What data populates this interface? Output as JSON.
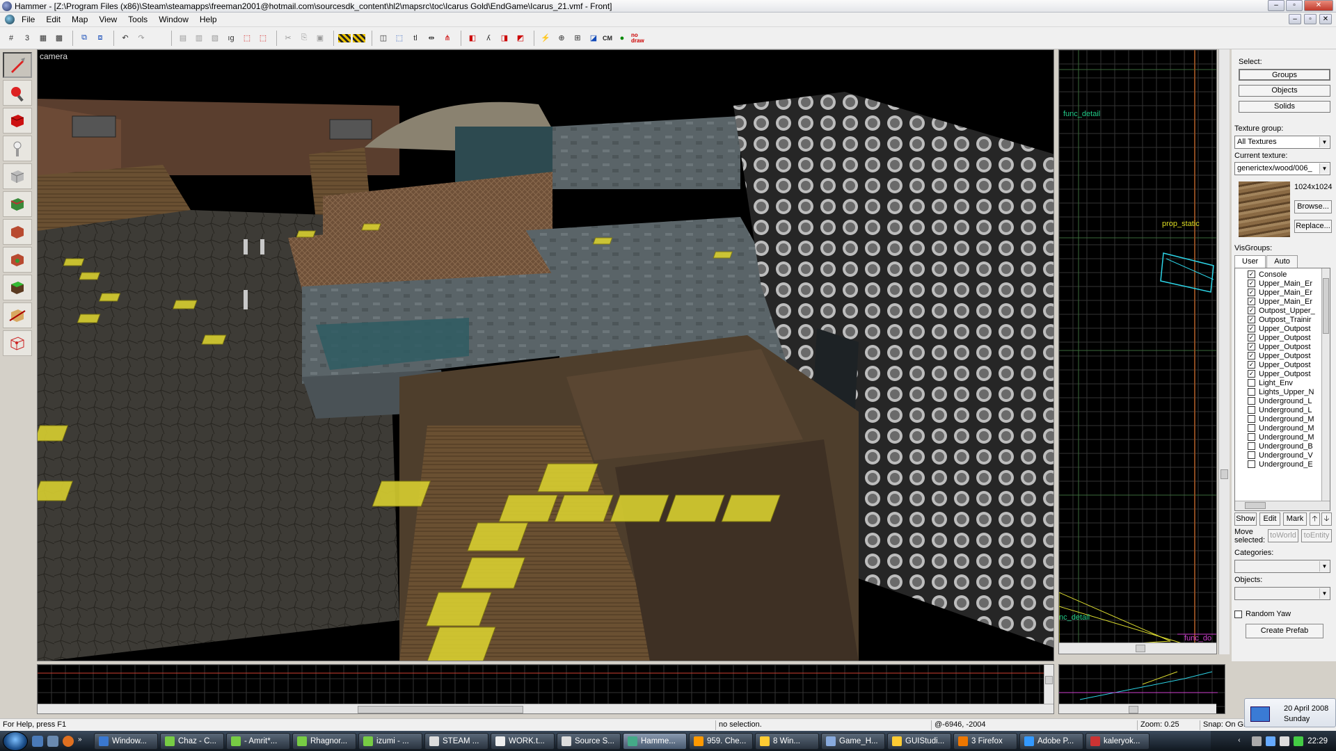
{
  "window": {
    "title": "Hammer - [Z:\\Program Files (x86)\\Steam\\steamapps\\freeman2001@hotmail.com\\sourcesdk_content\\hl2\\mapsrc\\toc\\Icarus Gold\\EndGame\\Icarus_21.vmf - Front]",
    "minimize": "–",
    "maximize": "▫",
    "close": "✕"
  },
  "menu": [
    "File",
    "Edit",
    "Map",
    "View",
    "Tools",
    "Window",
    "Help"
  ],
  "toolbar": {
    "cordon_label": "CM",
    "nodraw_label": "no draw"
  },
  "view3d": {
    "label": "camera"
  },
  "view2d": {
    "labels": [
      "func_detail",
      "prop_static",
      "nc_detail",
      "func_do"
    ]
  },
  "panel": {
    "select_label": "Select:",
    "groups_btn": "Groups",
    "objects_btn": "Objects",
    "solids_btn": "Solids",
    "texture_group_label": "Texture group:",
    "texture_group_value": "All Textures",
    "current_texture_label": "Current texture:",
    "current_texture_value": "generictex/wood/006_",
    "texture_size": "1024x1024",
    "browse_btn": "Browse...",
    "replace_btn": "Replace...",
    "visgroups_label": "VisGroups:",
    "tab_user": "User",
    "tab_auto": "Auto",
    "visgroups": [
      {
        "name": "Console",
        "checked": true
      },
      {
        "name": "Upper_Main_Er",
        "checked": true
      },
      {
        "name": "Upper_Main_Er",
        "checked": true
      },
      {
        "name": "Upper_Main_Er",
        "checked": true
      },
      {
        "name": "Outpost_Upper_",
        "checked": true
      },
      {
        "name": "Outpost_Trainir",
        "checked": true
      },
      {
        "name": "Upper_Outpost",
        "checked": true
      },
      {
        "name": "Upper_Outpost",
        "checked": true
      },
      {
        "name": "Upper_Outpost",
        "checked": true
      },
      {
        "name": "Upper_Outpost",
        "checked": true
      },
      {
        "name": "Upper_Outpost",
        "checked": true
      },
      {
        "name": "Upper_Outpost",
        "checked": true
      },
      {
        "name": "Light_Env",
        "checked": false
      },
      {
        "name": "Lights_Upper_N",
        "checked": false
      },
      {
        "name": "Underground_L",
        "checked": false
      },
      {
        "name": "Underground_L",
        "checked": false
      },
      {
        "name": "Underground_M",
        "checked": false
      },
      {
        "name": "Underground_M",
        "checked": false
      },
      {
        "name": "Underground_M",
        "checked": false
      },
      {
        "name": "Underground_B",
        "checked": false
      },
      {
        "name": "Underground_V",
        "checked": false
      },
      {
        "name": "Underground_E",
        "checked": false
      }
    ],
    "show_btn": "Show",
    "edit_btn": "Edit",
    "mark_btn": "Mark",
    "up_btn": "🡡",
    "down_btn": "🡣",
    "move_selected_label": "Move selected:",
    "toworld_btn": "toWorld",
    "toentity_btn": "toEntity",
    "categories_label": "Categories:",
    "objects_label": "Objects:",
    "random_yaw_label": "Random Yaw",
    "create_prefab_btn": "Create Prefab"
  },
  "status": {
    "help": "For Help, press F1",
    "selection": "no selection.",
    "coords": "@-6946, -2004",
    "zoom": "Zoom: 0.25",
    "snap": "Snap: On Gr"
  },
  "date": {
    "date": "20 April 2008",
    "day": "Sunday"
  },
  "taskbar": {
    "tasks": [
      {
        "label": "Window...",
        "color": "#3a78d0"
      },
      {
        "label": "Chaz - C...",
        "color": "#7c4"
      },
      {
        "label": "- Amrit*...",
        "color": "#7c4"
      },
      {
        "label": "Rhagnor...",
        "color": "#7c4"
      },
      {
        "label": "izumi - ...",
        "color": "#7c4"
      },
      {
        "label": "STEAM ...",
        "color": "#ddd"
      },
      {
        "label": "WORK.t...",
        "color": "#eee"
      },
      {
        "label": "Source S...",
        "color": "#ddd"
      },
      {
        "label": "Hamme...",
        "color": "#4a8"
      },
      {
        "label": "959. Che...",
        "color": "#f90"
      },
      {
        "label": "8 Win...",
        "color": "#fc3"
      },
      {
        "label": "Game_H...",
        "color": "#8ad"
      },
      {
        "label": "GUIStudi...",
        "color": "#fc3"
      },
      {
        "label": "3 Firefox",
        "color": "#e70"
      },
      {
        "label": "Adobe P...",
        "color": "#39f"
      },
      {
        "label": "kaleryok...",
        "color": "#c33"
      }
    ],
    "clock": "22:29"
  }
}
